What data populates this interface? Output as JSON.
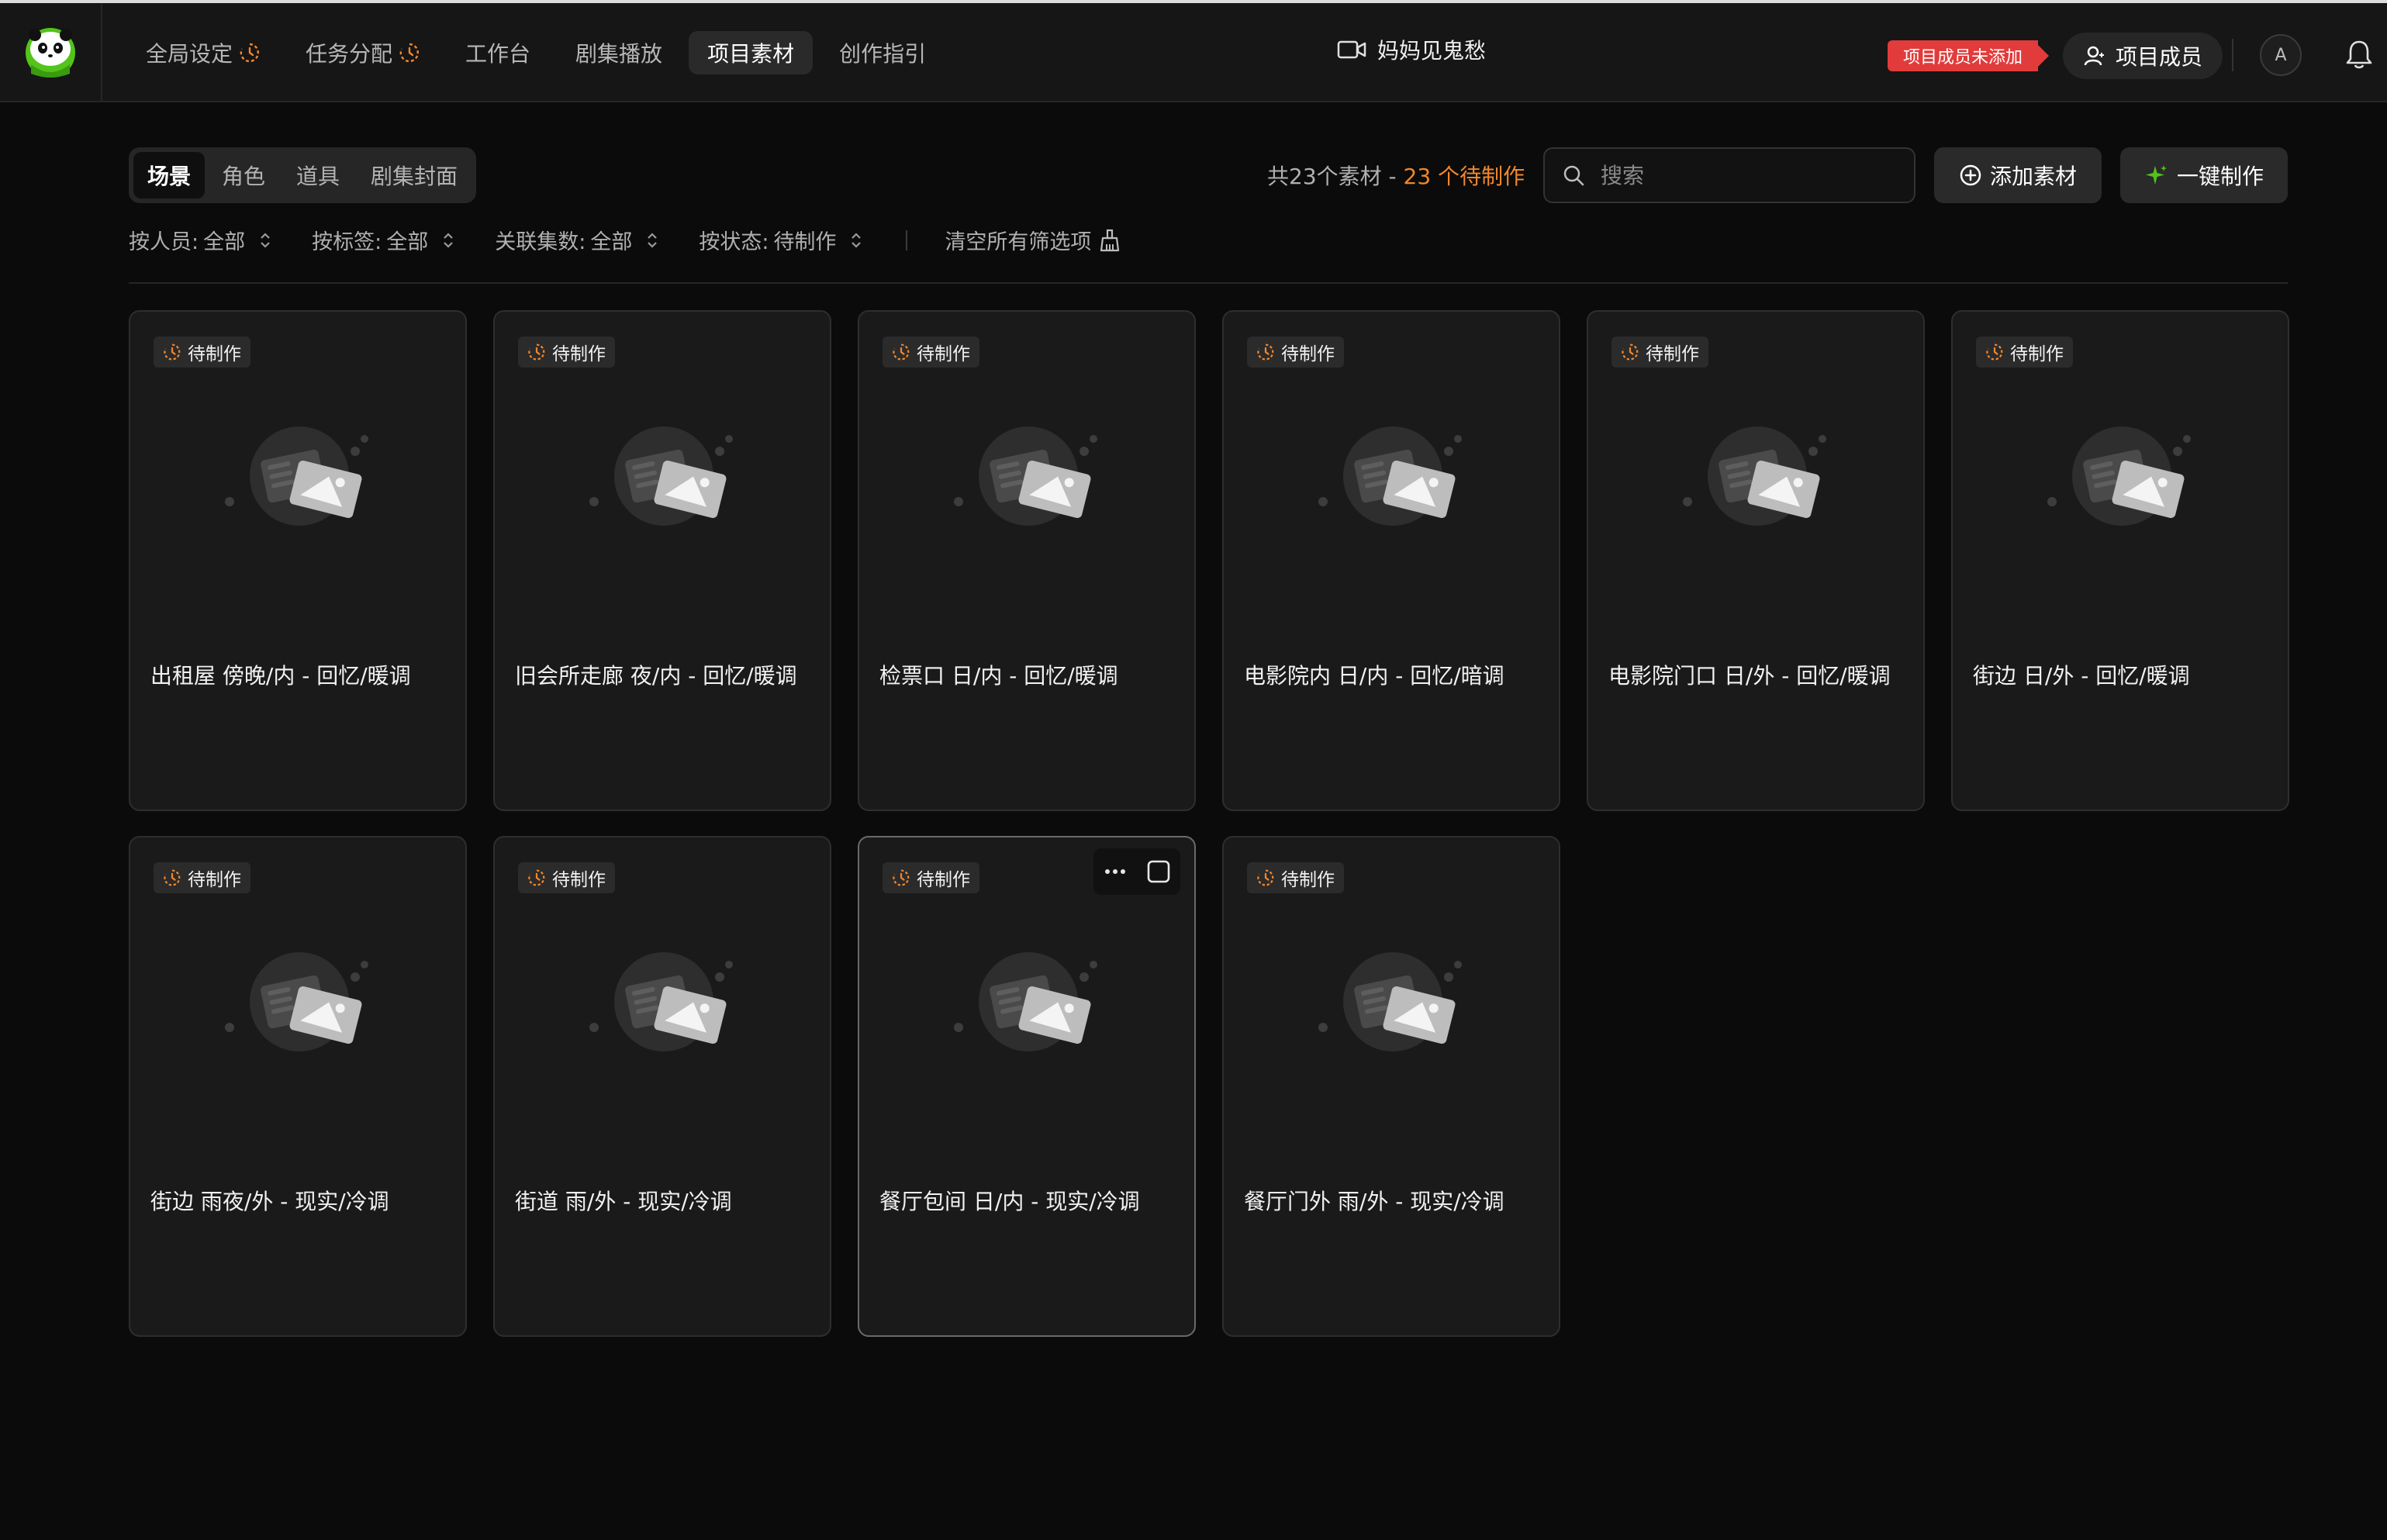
{
  "nav": {
    "items": [
      {
        "label": "全局设定",
        "pending": true,
        "active": false
      },
      {
        "label": "任务分配",
        "pending": true,
        "active": false
      },
      {
        "label": "工作台",
        "pending": false,
        "active": false
      },
      {
        "label": "剧集播放",
        "pending": false,
        "active": false
      },
      {
        "label": "项目素材",
        "pending": false,
        "active": true
      },
      {
        "label": "创作指引",
        "pending": false,
        "active": false
      }
    ]
  },
  "header": {
    "project_title": "妈妈见鬼愁",
    "member_warning": "项目成员未添加",
    "members_label": "项目成员",
    "avatar_initial": "A"
  },
  "toolbar": {
    "type_tabs": [
      "场景",
      "角色",
      "道具",
      "剧集封面"
    ],
    "active_tab": 0,
    "count_prefix": "共23个素材 - ",
    "count_highlight": "23 个待制作",
    "search_placeholder": "搜索",
    "add_label": "添加素材",
    "oneclick_label": "一键制作"
  },
  "filters": [
    {
      "label": "按人员:",
      "value": "全部"
    },
    {
      "label": "按标签:",
      "value": "全部"
    },
    {
      "label": "关联集数:",
      "value": "全部"
    },
    {
      "label": "按状态:",
      "value": "待制作"
    }
  ],
  "clear_filters_label": "清空所有筛选项",
  "cards": [
    {
      "status": "待制作",
      "title": "出租屋 傍晚/内 - 回忆/暖调"
    },
    {
      "status": "待制作",
      "title": "旧会所走廊 夜/内 - 回忆/暖调"
    },
    {
      "status": "待制作",
      "title": "检票口 日/内 - 回忆/暖调"
    },
    {
      "status": "待制作",
      "title": "电影院内 日/内 - 回忆/暗调"
    },
    {
      "status": "待制作",
      "title": "电影院门口 日/外 - 回忆/暖调"
    },
    {
      "status": "待制作",
      "title": "街边 日/外 - 回忆/暖调"
    },
    {
      "status": "待制作",
      "title": "街边 雨夜/外 - 现实/冷调"
    },
    {
      "status": "待制作",
      "title": "街道 雨/外 - 现实/冷调"
    },
    {
      "status": "待制作",
      "title": "餐厅包间 日/内 - 现实/冷调",
      "hovered": true
    },
    {
      "status": "待制作",
      "title": "餐厅门外 雨/外 - 现实/冷调"
    }
  ],
  "colors": {
    "accent_orange": "#f0872d",
    "warning_red": "#e23b3b",
    "logo_green": "#52c41a"
  }
}
